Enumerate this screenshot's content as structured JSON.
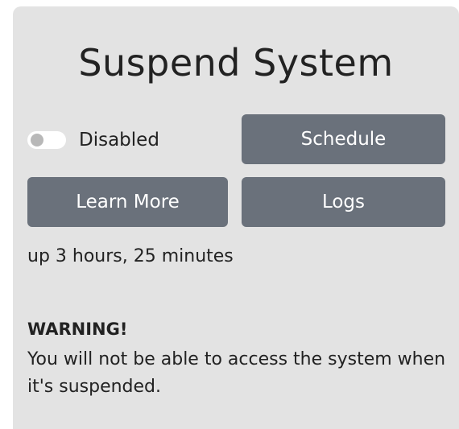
{
  "panel": {
    "title": "Suspend System"
  },
  "toggle": {
    "label": "Disabled",
    "state": "off"
  },
  "buttons": {
    "schedule": "Schedule",
    "learn_more": "Learn More",
    "logs": "Logs"
  },
  "status": {
    "uptime": "up 3 hours, 25 minutes"
  },
  "warning": {
    "title": "WARNING!",
    "message": "You will not be able to access the system when it's suspended."
  },
  "colors": {
    "panel_background": "#e3e3e3",
    "button_background": "#6a717b",
    "button_text": "#ffffff",
    "text": "#222222"
  }
}
